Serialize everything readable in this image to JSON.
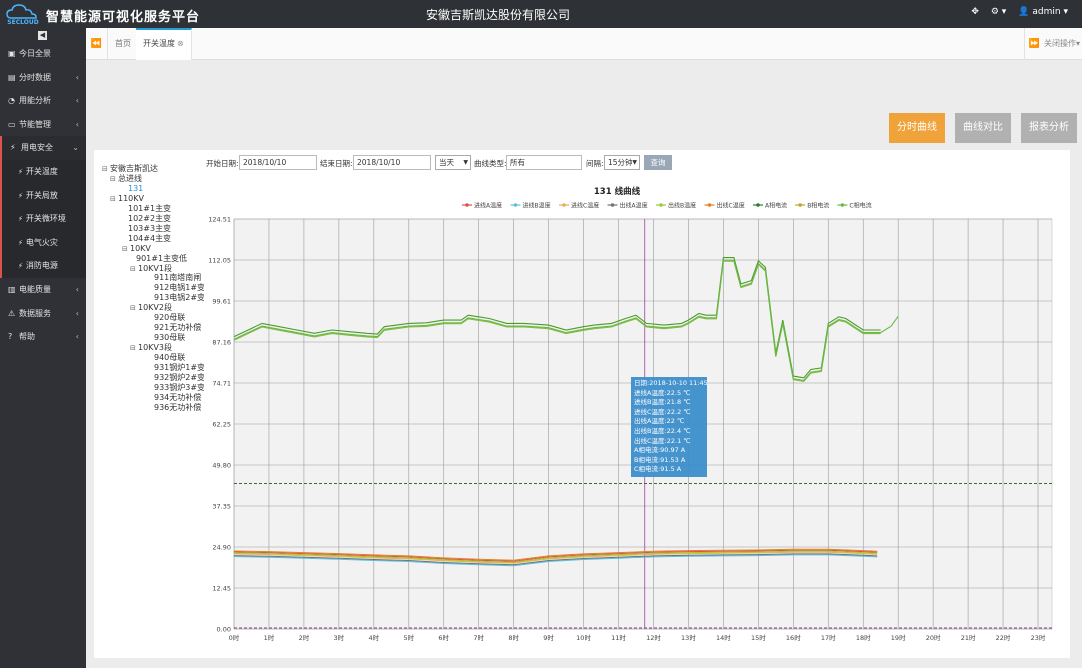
{
  "header": {
    "logo_text": "SECLOUD",
    "brand_title": "智慧能源可视化服务平台",
    "company": "安徽吉斯凯达股份有限公司",
    "user": "admin",
    "icons": [
      "expand-icon",
      "gear-icon",
      "user-icon"
    ]
  },
  "sidebar": {
    "collapse_symbol": "◀",
    "items": [
      {
        "label": "今日全景",
        "icon": "monitor-icon",
        "chevron": ""
      },
      {
        "label": "分时数据",
        "icon": "bar-chart-icon",
        "chevron": "‹"
      },
      {
        "label": "用能分析",
        "icon": "pie-chart-icon",
        "chevron": "‹"
      },
      {
        "label": "节能管理",
        "icon": "briefcase-icon",
        "chevron": "‹"
      },
      {
        "label": "用电安全",
        "icon": "bolt-icon",
        "chevron": "⌄"
      }
    ],
    "subitems": [
      {
        "label": "开关温度"
      },
      {
        "label": "开关局放"
      },
      {
        "label": "开关微环境"
      },
      {
        "label": "电气火灾"
      },
      {
        "label": "消防电源"
      }
    ],
    "items_after": [
      {
        "label": "电能质量",
        "icon": "bar-chart-icon",
        "chevron": "‹"
      },
      {
        "label": "数据服务",
        "icon": "warning-icon",
        "chevron": "‹"
      },
      {
        "label": "帮助",
        "icon": "question-icon",
        "chevron": "‹"
      }
    ]
  },
  "tabs": {
    "items": [
      {
        "label": "首页"
      },
      {
        "label": "开关温度"
      }
    ],
    "close_ops": "关闭操作",
    "close_symbol": "▾"
  },
  "actions": {
    "time_curve": "分时曲线",
    "curve_compare": "曲线对比",
    "report": "报表分析"
  },
  "tree": {
    "nodes": [
      {
        "label": "安徽吉斯凯达",
        "toggle": "⊟",
        "level": 0
      },
      {
        "label": "总进线",
        "toggle": "⊟",
        "level": 1
      },
      {
        "label": "131",
        "toggle": "",
        "level": 2,
        "selected": true
      },
      {
        "label": "110KV",
        "toggle": "⊟",
        "level": 1
      },
      {
        "label": "101#1主变",
        "toggle": "",
        "level": 2
      },
      {
        "label": "102#2主变",
        "toggle": "",
        "level": 2
      },
      {
        "label": "103#3主变",
        "toggle": "",
        "level": 2
      },
      {
        "label": "104#4主变",
        "toggle": "",
        "level": 2
      },
      {
        "label": "10KV",
        "toggle": "⊟",
        "level": 2
      },
      {
        "label": "901#1主变低",
        "toggle": "",
        "level": 3
      },
      {
        "label": "10KV1段",
        "toggle": "⊟",
        "level": 3
      },
      {
        "label": "911南塔南闸",
        "toggle": "",
        "level": 4
      },
      {
        "label": "912电锅1#变",
        "toggle": "",
        "level": 4
      },
      {
        "label": "913电锅2#变",
        "toggle": "",
        "level": 4
      },
      {
        "label": "10KV2段",
        "toggle": "⊟",
        "level": 3
      },
      {
        "label": "920母联",
        "toggle": "",
        "level": 4
      },
      {
        "label": "921无功补偿",
        "toggle": "",
        "level": 4
      },
      {
        "label": "930母联",
        "toggle": "",
        "level": 4
      },
      {
        "label": "10KV3段",
        "toggle": "⊟",
        "level": 3
      },
      {
        "label": "940母联",
        "toggle": "",
        "level": 4
      },
      {
        "label": "931钢炉1#变",
        "toggle": "",
        "level": 4
      },
      {
        "label": "932钢炉2#变",
        "toggle": "",
        "level": 4
      },
      {
        "label": "933钢炉3#变",
        "toggle": "",
        "level": 4
      },
      {
        "label": "934无功补偿",
        "toggle": "",
        "level": 4
      },
      {
        "label": "936无功补偿",
        "toggle": "",
        "level": 4
      }
    ]
  },
  "filter": {
    "start_label": "开始日期:",
    "start_value": "2018/10/10",
    "end_label": "结束日期:",
    "end_value": "2018/10/10",
    "range_value": "当天",
    "curve_type_label": "曲线类型:",
    "curve_type_value": "所有",
    "interval_label": "间隔:",
    "interval_value": "15分钟",
    "query_label": "查询"
  },
  "tooltip": {
    "lines": [
      "日期:2018-10-10 11:45",
      "进线A温度:22.5 ℃",
      "进线B温度:21.8 ℃",
      "进线C温度:22.2 ℃",
      "出线A温度:22 ℃",
      "出线B温度:22.4 ℃",
      "出线C温度:22.1 ℃",
      "A相电流:90.97 A",
      "B相电流:91.53 A",
      "C相电流:91.5 A"
    ]
  },
  "chart_data": {
    "type": "line",
    "title": "131 线曲线",
    "y_ticks": [
      "124.51",
      "112.05",
      "99.61",
      "87.16",
      "74.71",
      "62.25",
      "49.80",
      "37.35",
      "24.90",
      "12.45",
      "0.00"
    ],
    "x_ticks": [
      "0时",
      "1时",
      "2时",
      "3时",
      "4时",
      "5时",
      "6时",
      "7时",
      "8时",
      "9时",
      "10时",
      "11时",
      "12时",
      "13时",
      "14时",
      "15时",
      "16时",
      "17时",
      "18时",
      "19时",
      "20时",
      "21时",
      "22时",
      "23时"
    ],
    "ylim": [
      0,
      124.51
    ],
    "xlim": [
      0,
      23.4
    ],
    "grid": true,
    "legend_position": "top",
    "reference_lines": [
      {
        "value": 44.2,
        "style": "dashed",
        "color": "#3a6b2c"
      },
      {
        "value": 0,
        "style": "dashed",
        "color": "#8b3a8b"
      }
    ],
    "crosshair_x": 11.75,
    "series": [
      {
        "name": "进线A温度",
        "color": "#d9534f",
        "group": "temp"
      },
      {
        "name": "进线B温度",
        "color": "#5bc0de",
        "group": "temp"
      },
      {
        "name": "进线C温度",
        "color": "#f0ad4e",
        "group": "temp"
      },
      {
        "name": "出线A温度",
        "color": "#6c757d",
        "group": "temp"
      },
      {
        "name": "出线B温度",
        "color": "#9acd32",
        "group": "temp"
      },
      {
        "name": "出线C温度",
        "color": "#e67e22",
        "group": "temp"
      },
      {
        "name": "A相电流",
        "color": "#2e7d32",
        "group": "current"
      },
      {
        "name": "B相电流",
        "color": "#c9a227",
        "group": "current"
      },
      {
        "name": "C相电流",
        "color": "#66bb44",
        "group": "current"
      }
    ],
    "temperature_points": {
      "x": [
        0,
        1,
        2,
        3,
        4,
        5,
        6,
        7,
        8,
        9,
        10,
        11,
        12,
        13,
        14,
        15,
        16,
        17,
        18,
        18.4
      ],
      "y": [
        22.5,
        22.3,
        22.0,
        21.7,
        21.3,
        21.0,
        20.4,
        20.0,
        19.7,
        21.0,
        21.6,
        22.0,
        22.4,
        22.6,
        22.7,
        22.8,
        23.0,
        23.0,
        22.6,
        22.4
      ]
    },
    "current_points": {
      "x": [
        0,
        0.3,
        0.8,
        1.3,
        1.8,
        2.3,
        2.8,
        3.3,
        3.8,
        4.1,
        4.3,
        5.0,
        5.5,
        6.0,
        6.5,
        6.7,
        7.0,
        7.3,
        7.8,
        8.3,
        9.0,
        9.5,
        10.0,
        10.3,
        10.8,
        11.2,
        11.5,
        11.8,
        12.3,
        12.8,
        13.0,
        13.3,
        13.5,
        13.8,
        14.0,
        14.3,
        14.5,
        14.8,
        15.0,
        15.1,
        15.2,
        15.5,
        15.7,
        16.0,
        16.3,
        16.5,
        16.8,
        17.0,
        17.3,
        17.5,
        18.0,
        18.5
      ],
      "y": [
        88,
        89.5,
        92,
        91,
        90,
        89,
        90,
        89.5,
        89,
        88.8,
        91,
        92,
        92.2,
        93,
        93,
        94.5,
        94,
        93.5,
        92,
        92,
        91.5,
        90,
        91,
        91.5,
        92,
        93.5,
        94.5,
        92,
        91.5,
        92,
        93,
        95,
        94.5,
        94.5,
        112,
        112,
        104,
        105,
        111,
        110,
        109,
        83,
        93,
        76,
        75.5,
        78,
        78.5,
        92,
        94,
        93.5,
        90,
        90
      ]
    },
    "current_points_tail": {
      "x": [
        18.5,
        18.8,
        19.0
      ],
      "y": [
        90,
        92,
        95
      ]
    }
  }
}
